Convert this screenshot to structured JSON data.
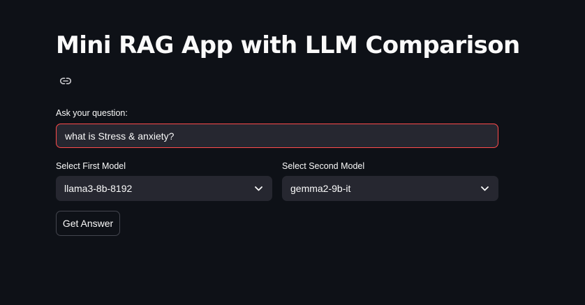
{
  "app": {
    "title": "Mini RAG App with LLM Comparison"
  },
  "question": {
    "label": "Ask your question:",
    "value": "what is Stress & anxiety?"
  },
  "first_model": {
    "label": "Select First Model",
    "selected": "llama3-8b-8192"
  },
  "second_model": {
    "label": "Select Second Model",
    "selected": "gemma2-9b-it"
  },
  "actions": {
    "get_answer_label": "Get Answer"
  },
  "icons": {
    "anchor": "link-icon",
    "dropdown": "chevron-down-icon"
  },
  "colors": {
    "background": "#0e1117",
    "input_background": "#262730",
    "focus_border": "#ff4b4b",
    "text": "#fafafa"
  }
}
